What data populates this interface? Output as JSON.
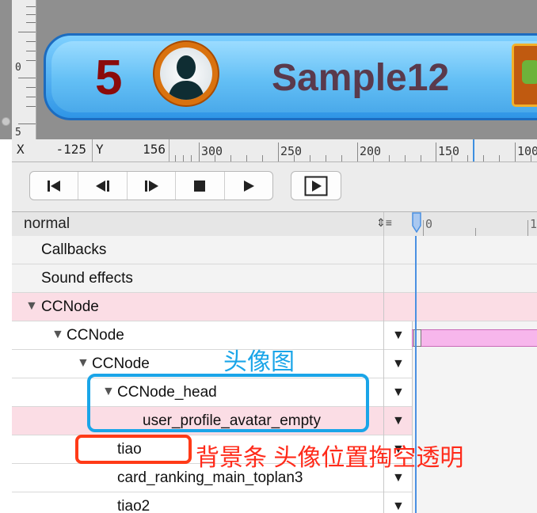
{
  "canvas_preview": {
    "ruler_numbers": [
      "0",
      "5"
    ],
    "banner": {
      "rank": "5",
      "player_name": "Sample12"
    }
  },
  "coordinates": {
    "x_label": "X",
    "x_value": "-125",
    "y_label": "Y",
    "y_value": "156",
    "ruler_numbers": [
      "300",
      "250",
      "200",
      "150",
      "100"
    ]
  },
  "playback": {
    "buttons": [
      "jump-to-start",
      "step-back",
      "step-forward",
      "stop",
      "play",
      "play-once"
    ]
  },
  "timeline": {
    "sequence_name": "normal",
    "sequence_control_glyph": "⇕≡",
    "ticks": [
      "0",
      "1"
    ],
    "rows": [
      {
        "label": "Callbacks"
      },
      {
        "label": "Sound effects"
      },
      {
        "label": "CCNode",
        "expanded": true
      },
      {
        "label": "CCNode",
        "expanded": true
      },
      {
        "label": "CCNode",
        "expanded": true
      },
      {
        "label": "CCNode_head",
        "expanded": true
      },
      {
        "label": "user_profile_avatar_empty"
      },
      {
        "label": "tiao"
      },
      {
        "label": "card_ranking_main_toplan3"
      },
      {
        "label": "tiao2"
      }
    ]
  },
  "annotations": {
    "blue_label": "头像图",
    "red_label": "背景条 头像位置掏空透明",
    "blue_color": "#1aa5e8",
    "red_color": "#ff3a17"
  },
  "colors": {
    "selected_row": "#fbdde5",
    "keyframe_bar": "#f7b6ec",
    "playhead": "#4a90e2"
  }
}
